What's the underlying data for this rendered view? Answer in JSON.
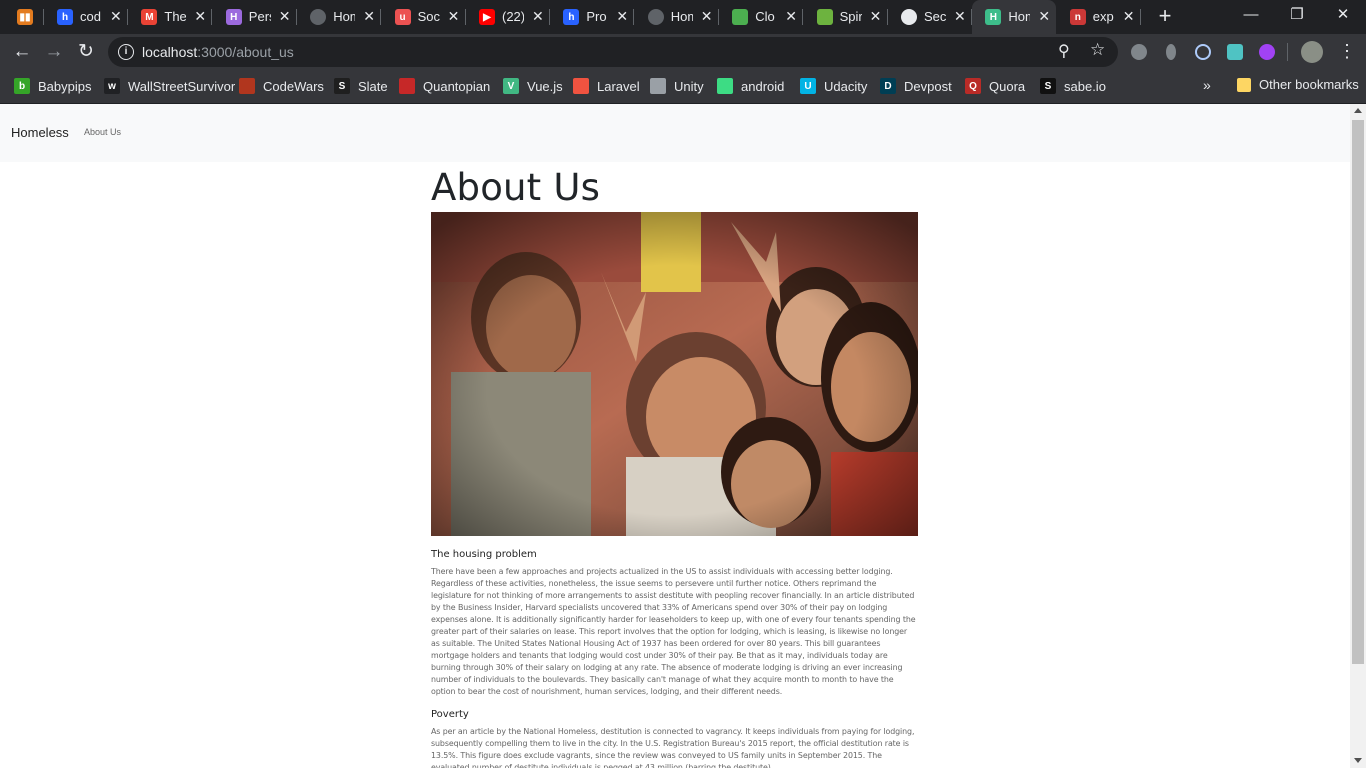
{
  "tabs": [
    {
      "title": "cod",
      "icon": "hashnode-icon",
      "color": "#2962ff",
      "glyph": "h"
    },
    {
      "title": "The",
      "icon": "gmail-icon",
      "color": "#ea4335",
      "glyph": "M"
    },
    {
      "title": "Pers",
      "icon": "heroku-icon",
      "color": "#9c6ade",
      "glyph": "H"
    },
    {
      "title": "Hom",
      "icon": "globe-icon",
      "color": "#5f6368",
      "glyph": ""
    },
    {
      "title": "Soc",
      "icon": "udemy-icon",
      "color": "#ec5252",
      "glyph": "u"
    },
    {
      "title": "(22)",
      "icon": "youtube-icon",
      "color": "#ff0000",
      "glyph": "▶"
    },
    {
      "title": "Pro",
      "icon": "hashnode-icon",
      "color": "#2962ff",
      "glyph": "h"
    },
    {
      "title": "Hom",
      "icon": "globe-icon",
      "color": "#5f6368",
      "glyph": ""
    },
    {
      "title": "Clo",
      "icon": "leaf-icon",
      "color": "#4caf50",
      "glyph": ""
    },
    {
      "title": "Spir",
      "icon": "spring-icon",
      "color": "#6db33f",
      "glyph": ""
    },
    {
      "title": "Sec",
      "icon": "github-icon",
      "color": "#e8eaed",
      "glyph": ""
    },
    {
      "title": "Hom",
      "icon": "homeless-h-icon",
      "color": "#3dbd8a",
      "glyph": "H"
    },
    {
      "title": "exp",
      "icon": "npm-icon",
      "color": "#cb3837",
      "glyph": "n"
    }
  ],
  "first_tab_icon": {
    "icon": "trello-icon",
    "color": "#e37b1f"
  },
  "active_tab_index": 11,
  "address": {
    "host": "localhost",
    "path": ":3000/about_us"
  },
  "bookmarks": [
    {
      "label": "Babypips",
      "icon": "babypips-icon",
      "color": "#35a528",
      "glyph": "b"
    },
    {
      "label": "WallStreetSurvivor",
      "icon": "wallstreetsurvivor-icon",
      "color": "#202124",
      "glyph": "w"
    },
    {
      "label": "CodeWars",
      "icon": "codewars-icon",
      "color": "#b1361e",
      "glyph": ""
    },
    {
      "label": "Slate",
      "icon": "slate-icon",
      "color": "#1f1f1f",
      "glyph": "S"
    },
    {
      "label": "Quantopian",
      "icon": "quantopian-icon",
      "color": "#c62828",
      "glyph": ""
    },
    {
      "label": "Vue.js",
      "icon": "vue-icon",
      "color": "#41b883",
      "glyph": "V"
    },
    {
      "label": "Laravel",
      "icon": "laravel-icon",
      "color": "#f05340",
      "glyph": ""
    },
    {
      "label": "Unity",
      "icon": "unity-icon",
      "color": "#9aa0a6",
      "glyph": ""
    },
    {
      "label": "android",
      "icon": "android-icon",
      "color": "#3ddc84",
      "glyph": ""
    },
    {
      "label": "Udacity",
      "icon": "udacity-icon",
      "color": "#02b3e4",
      "glyph": "U"
    },
    {
      "label": "Devpost",
      "icon": "devpost-icon",
      "color": "#003e54",
      "glyph": "D"
    },
    {
      "label": "Quora",
      "icon": "quora-icon",
      "color": "#b92b27",
      "glyph": "Q"
    },
    {
      "label": "sabe.io",
      "icon": "sabe-icon",
      "color": "#111111",
      "glyph": "S"
    }
  ],
  "bookmarks_more": "»",
  "other_bookmarks": "Other bookmarks",
  "page": {
    "brand": "Homeless",
    "nav_about": "About Us",
    "title": "About Us",
    "section1_heading": "The housing problem",
    "section1_text": "There have been a few approaches and projects actualized in the US to assist individuals with accessing better lodging. Regardless of these activities, nonetheless, the issue seems to persevere until further notice. Others reprimand the legislature for not thinking of more arrangements to assist destitute with peopling recover financially. In an article distributed by the Business Insider, Harvard specialists uncovered that 33% of Americans spend over 30% of their pay on lodging expenses alone. It is additionally significantly harder for leaseholders to keep up, with one of every four tenants spending the greater part of their salaries on lease. This report involves that the option for lodging, which is leasing, is likewise no longer as suitable. The United States National Housing Act of 1937 has been ordered for over 80 years. This bill guarantees mortgage holders and tenants that lodging would cost under 30% of their pay. Be that as it may, individuals today are burning through 30% of their salary on lodging at any rate. The absence of moderate lodging is driving an ever increasing number of individuals to the boulevards. They basically can't manage of what they acquire month to month to have the option to bear the cost of nourishment, human services, lodging, and their different needs.",
    "section2_heading": "Poverty",
    "section2_text": "As per an article by the National Homeless, destitution is connected to vagrancy. It keeps individuals from paying for lodging, subsequently compelling them to live in the city. In the U.S. Registration Bureau's 2015 report, the official destitution rate is 13.5%. This figure does exclude vagrants, since the review was conveyed to US family units in September 2015. The evaluated number of destitute individuals is pegged at 43 million (barring the destitute)."
  },
  "scroll_fraction": 0.0
}
